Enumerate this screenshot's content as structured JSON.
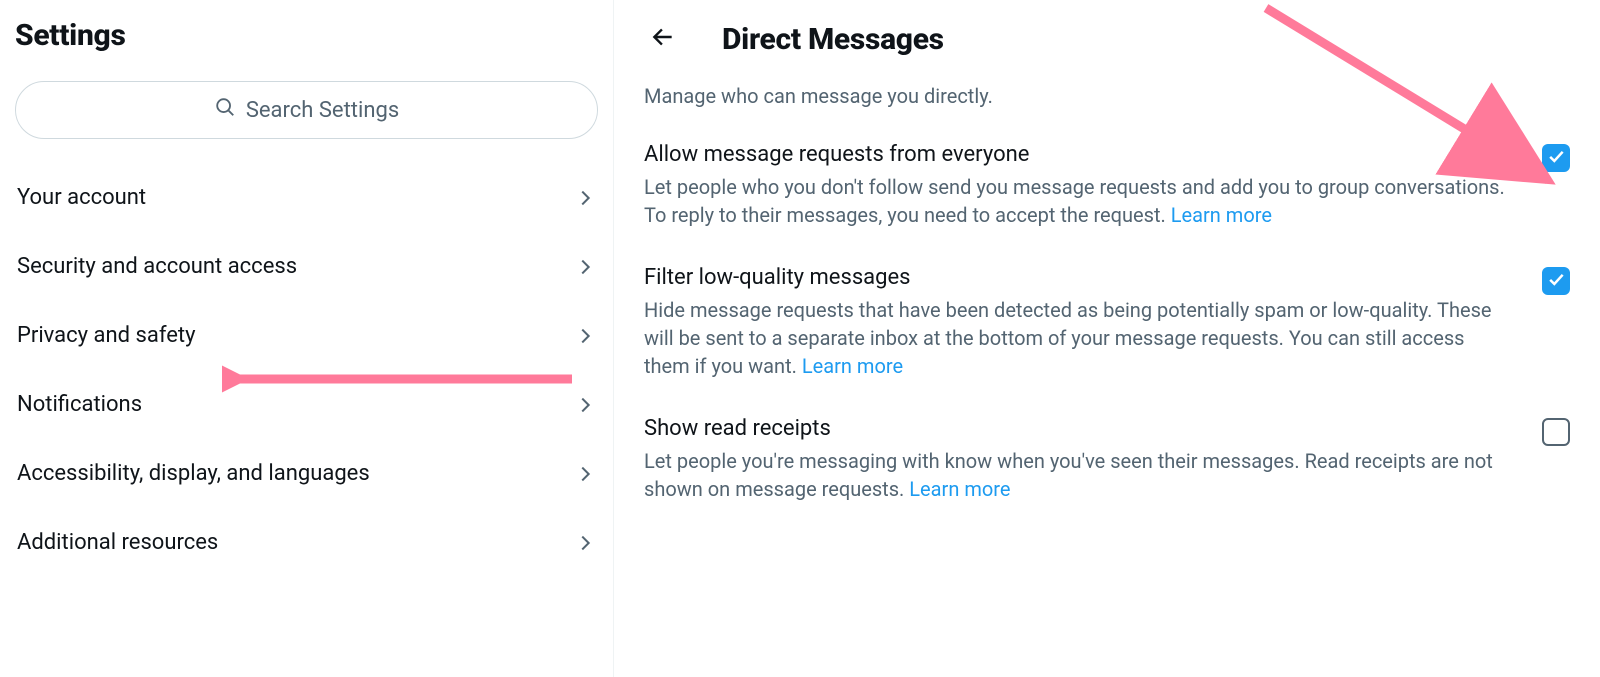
{
  "sidebar": {
    "title": "Settings",
    "search_placeholder": "Search Settings",
    "items": [
      {
        "label": "Your account"
      },
      {
        "label": "Security and account access"
      },
      {
        "label": "Privacy and safety"
      },
      {
        "label": "Notifications"
      },
      {
        "label": "Accessibility, display, and languages"
      },
      {
        "label": "Additional resources"
      }
    ]
  },
  "main": {
    "title": "Direct Messages",
    "subtitle": "Manage who can message you directly.",
    "learn_more_label": "Learn more",
    "settings": [
      {
        "title": "Allow message requests from everyone",
        "desc": "Let people who you don't follow send you message requests and add you to group conversations. To reply to their messages, you need to accept the request. ",
        "checked": true,
        "has_learn_more": true
      },
      {
        "title": "Filter low-quality messages",
        "desc": "Hide message requests that have been detected as being potentially spam or low-quality. These will be sent to a separate inbox at the bottom of your message requests. You can still access them if you want. ",
        "checked": true,
        "has_learn_more": true
      },
      {
        "title": "Show read receipts",
        "desc": "Let people you're messaging with know when you've seen their messages. Read receipts are not shown on message requests. ",
        "checked": false,
        "has_learn_more": true
      }
    ]
  },
  "annotation": {
    "arrow_color": "#ff7a9a"
  }
}
